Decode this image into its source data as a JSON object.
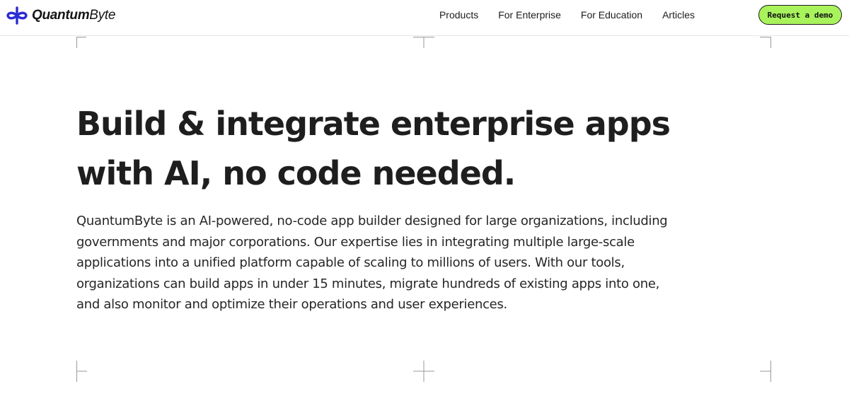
{
  "header": {
    "logo": {
      "part1": "Quantum",
      "part2": "Byte",
      "icon": "quantumbyte-logo-icon"
    },
    "nav": [
      {
        "label": "Products"
      },
      {
        "label": "For Enterprise"
      },
      {
        "label": "For Education"
      },
      {
        "label": "Articles"
      }
    ],
    "cta_label": "Request a demo"
  },
  "hero": {
    "title_line1": "Build & integrate enterprise apps",
    "title_line2": "with AI, no code needed.",
    "description": "QuantumByte is an AI-powered, no-code app builder designed for large organizations, including governments and major corporations. Our expertise lies in integrating multiple large-scale applications into a unified platform capable of scaling to millions of users. With our tools, organizations can build apps in under 15 minutes, migrate hundreds of existing apps into one, and also monitor and optimize their operations and user experiences."
  },
  "colors": {
    "brand_blue": "#2b2bd6",
    "cta_green": "#a8f25c",
    "text": "#1e1e1e",
    "guide_lines": "#9a9a9a"
  }
}
